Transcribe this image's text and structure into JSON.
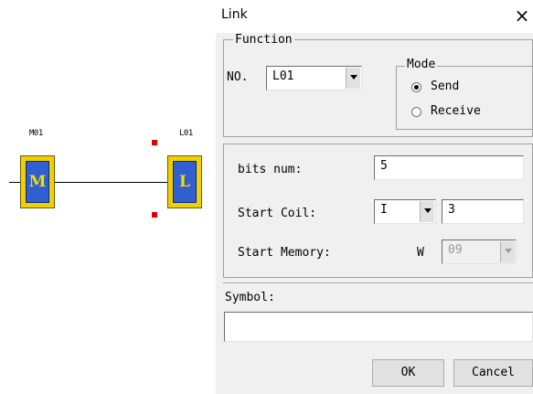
{
  "diagram": {
    "blocks": [
      {
        "tag": "M01",
        "letter": "M"
      },
      {
        "tag": "L01",
        "letter": "L"
      }
    ]
  },
  "dialog": {
    "title": "Link",
    "close_icon": "×",
    "function_group": {
      "label": "Function",
      "no_label": "NO.",
      "no_value": "L01",
      "mode_group": {
        "label": "Mode",
        "options": [
          "Send",
          "Receive"
        ],
        "selected": "Send"
      }
    },
    "bits_num": {
      "label": "bits num:",
      "value": "5"
    },
    "start_coil": {
      "label": "Start Coil:",
      "type_value": "I",
      "value": "3"
    },
    "start_memory": {
      "label": "Start Memory:",
      "prefix": "W",
      "value": "09"
    },
    "symbol": {
      "label": "Symbol:",
      "value": ""
    },
    "buttons": {
      "ok": "OK",
      "cancel": "Cancel"
    }
  }
}
